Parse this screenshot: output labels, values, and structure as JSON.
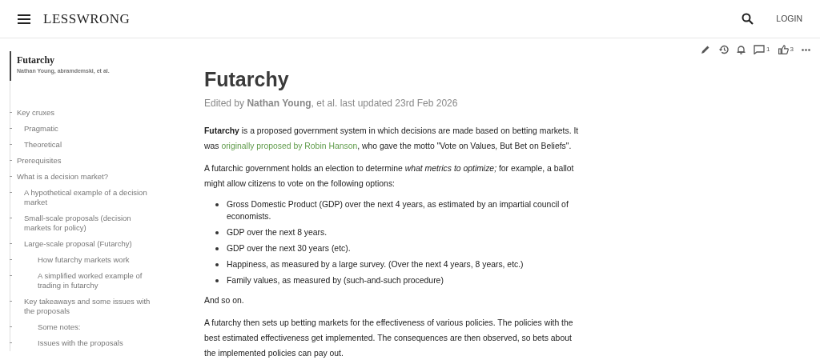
{
  "header": {
    "logo": "LESSWRONG",
    "login": "LOGIN"
  },
  "toolbar": {
    "comments": "1",
    "votes": "3"
  },
  "toc": {
    "title": "Futarchy",
    "authors": "Nathan Young, abramdemski, et al.",
    "items": [
      {
        "label": "Key cruxes",
        "children": [
          {
            "label": "Pragmatic"
          },
          {
            "label": "Theoretical"
          }
        ]
      },
      {
        "label": "Prerequisites"
      },
      {
        "label": "What is a decision market?",
        "children": [
          {
            "label": "A hypothetical example of a decision market"
          },
          {
            "label": "Small-scale proposals (decision markets for policy)"
          },
          {
            "label": "Large-scale proposal (Futarchy)",
            "children": [
              {
                "label": "How futarchy markets work"
              },
              {
                "label": "A simplified worked example of trading in futarchy"
              }
            ]
          },
          {
            "label": "Key takeaways and some issues with the proposals",
            "children": [
              {
                "label": "Some notes:"
              },
              {
                "label": "Issues with the proposals"
              }
            ]
          }
        ]
      }
    ]
  },
  "article": {
    "title": "Futarchy",
    "byline": "Edited by **Nathan Young**, et al. last updated 23rd Feb 2026",
    "blocks": [
      {
        "kind": "paragraph",
        "before": "**Futarchy** is a proposed government system in which decisions are made based on betting markets. It was ",
        "link": "originally proposed by Robin Hanson",
        "after": ", who gave the motto \"Vote on Values, But Bet on Beliefs\"."
      },
      {
        "kind": "paragraph",
        "before": "A futarchic government holds an election to determine *what metrics to optimize;* for example, a ballot might allow citizens to vote on the following options:"
      },
      {
        "kind": "list",
        "items": [
          "Gross Domestic Product (GDP) over the next 4 years, as estimated by an impartial council of economists.",
          "GDP over the next 8 years.",
          "GDP over the next 30 years (etc).",
          "Happiness, as measured by a large survey. (Over the next 4 years, 8 years, etc.)",
          "Family values, as measured by (such-and-such procedure)"
        ]
      },
      {
        "kind": "paragraph",
        "before": "And so on."
      },
      {
        "kind": "paragraph",
        "before": "A futarchy then sets up betting markets for the effectiveness of various policies. The policies with the best estimated effectiveness get implemented. The consequences are then observed, so bets about the implemented policies can pay out."
      }
    ]
  }
}
